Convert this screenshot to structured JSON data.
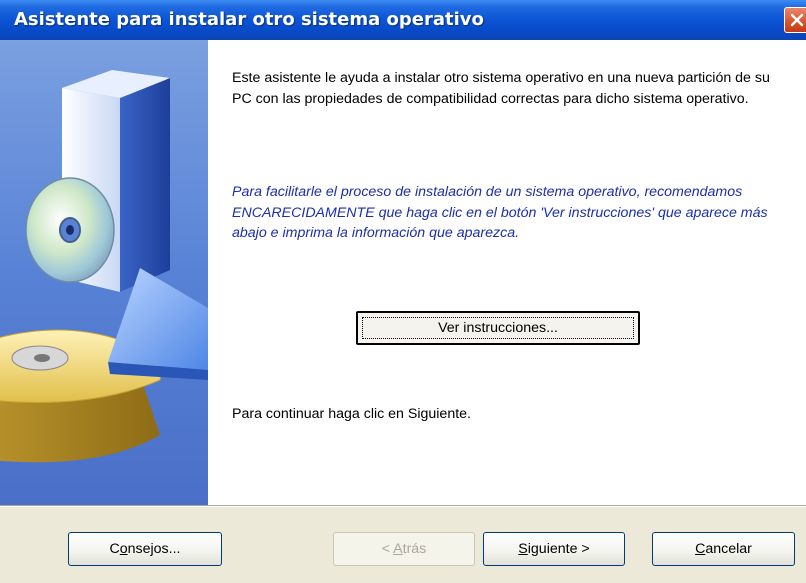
{
  "window": {
    "title": "Asistente para instalar otro sistema operativo"
  },
  "content": {
    "intro_text": "Este asistente le ayuda a instalar otro sistema operativo en una nueva partición de su PC con las propiedades de compatibilidad correctas para dicho sistema operativo.",
    "note_text": "Para facilitarle el proceso de instalación de un sistema operativo, recomendamos ENCARECIDAMENTE que haga clic en el botón 'Ver instrucciones' que aparece más abajo e imprima la información que aparezca.",
    "instructions_button": {
      "accel": "V",
      "rest": "er instrucciones..."
    },
    "continue_text": "Para continuar haga clic en Siguiente."
  },
  "buttons": {
    "tips": {
      "pre": "C",
      "accel": "o",
      "post": "nsejos..."
    },
    "back": {
      "pre": "< ",
      "accel": "A",
      "post": "trás",
      "enabled": false
    },
    "next": {
      "pre": "",
      "accel": "S",
      "post": "iguiente >"
    },
    "cancel": {
      "pre": "",
      "accel": "C",
      "post": "ancelar"
    }
  },
  "icons": {
    "close": "close-icon",
    "illustration": "wizard-illustration"
  },
  "colors": {
    "titlebar": "#0a54d6",
    "side_panel": "#5882d6",
    "note_text": "#1c2fa8",
    "close_button": "#d9532c"
  }
}
